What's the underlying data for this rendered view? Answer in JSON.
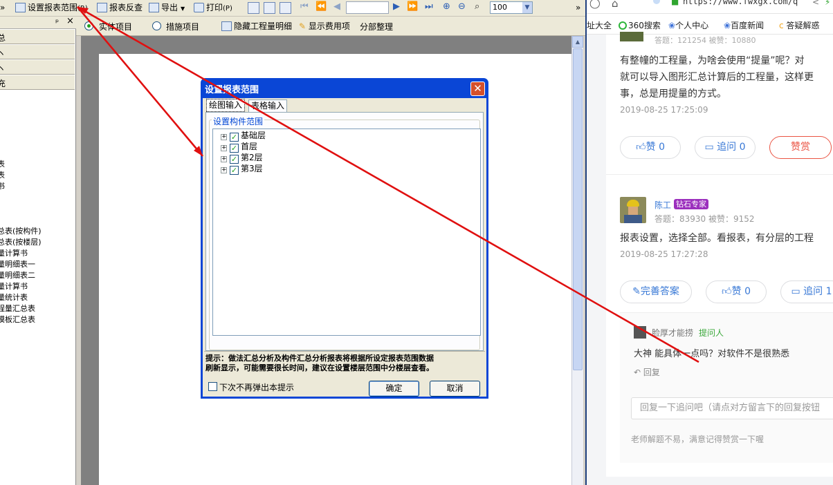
{
  "toolbar": {
    "set_range_label": "设置报表范围",
    "set_range_key": "(R)",
    "report_check_label": "报表反查",
    "export_label": "导出",
    "print_label": "打印",
    "print_key": "(P)",
    "zoom_value": "100",
    "more_chevron": "»"
  },
  "toolbar2": {
    "entity_label": "实体项目",
    "measure_label": "措施项目",
    "hide_detail_label": "隐藏工程量明细",
    "show_cost_label": "显示费用项",
    "partial_label": "分部整理"
  },
  "left_panel": {
    "pin": "ᵖ",
    "close": "×",
    "categories": [
      "总",
      "ヽ",
      "ヽ",
      "充"
    ],
    "items_a": [
      "表",
      "表",
      "书"
    ],
    "items_b": [
      "总表(按构件)",
      "总表(按楼层)",
      "量计算书",
      "量明细表一",
      "量明细表二",
      "量计算书",
      "量统计表",
      "程量汇总表",
      "模板汇总表"
    ]
  },
  "dialog": {
    "title": "设置报表范围",
    "tabs": [
      "绘图输入",
      "表格输入"
    ],
    "group_label": "设置构件范围",
    "tree_nodes": [
      "基础层",
      "首层",
      "第2层",
      "第3层"
    ],
    "hint_line1": "提示：做法汇总分析及构件汇总分析报表将根据所设定报表范围数据",
    "hint_line2": "刷新显示，可能需要很长时间，建议在设置楼层范围中分楼层查看。",
    "no_popup_label": "下次不再弹出本提示",
    "ok_label": "确定",
    "cancel_label": "取消"
  },
  "browser": {
    "url": "https://www.fwxgx.com/q",
    "bookmarks": [
      "址大全",
      "360搜索",
      "个人中心",
      "百度新闻",
      "答疑解惑"
    ],
    "top_stats": "答题：121254    被赞：10880",
    "answer1_lines": [
      "有整幢的工程量，为啥会使用“提量”呢？对",
      "就可以导入图形汇总计算后的工程量，这样更",
      "事，总是用提量的方式。"
    ],
    "answer1_time": "2019-08-25 17:25:09",
    "like0_label": "赞 0",
    "followup0_label": "追问  0",
    "reward_label": "赞赏",
    "user2_name": "陈工",
    "user2_badge": "钻石专家",
    "user2_stats": "答题：83930    被赞：9152",
    "answer2_text": "报表设置，选择全部。看报表，有分层的工程",
    "answer2_time": "2019-08-25 17:27:28",
    "improve_label": "完善答案",
    "like2_label": "赞 0",
    "followup2_label": "追问  1",
    "asker_name": "脸厚才能捞",
    "asker_role": "提问人",
    "asker_text": "大神 能具体一点吗？对软件不是很熟悉",
    "reply_label": "回复",
    "reply_placeholder": "回复一下追问吧（请点对方留言下的回复按钮",
    "footer_text": "老师解题不易，满意记得赞赏一下喔"
  },
  "colors": {
    "xp_blue": "#0a46d6",
    "arrow_red": "#e01010",
    "link_blue": "#3878d6",
    "reward_red": "#ea5342",
    "badge_purple": "#9b2fbd"
  }
}
